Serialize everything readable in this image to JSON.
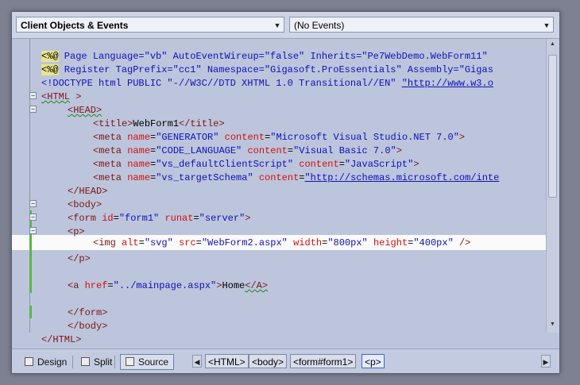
{
  "header": {
    "objects_combo": "Client Objects & Events",
    "events_combo": "(No Events)"
  },
  "code": {
    "l1_directive": "<%@",
    "l1_rest": " Page Language=\"vb\" AutoEventWireup=\"false\" Inherits=\"Pe7WebDemo.WebForm11\"",
    "l2_directive": "<%@",
    "l2_rest": " Register TagPrefix=\"cc1\" Namespace=\"Gigasoft.ProEssentials\" Assembly=\"Gigas",
    "l3_text": "<!DOCTYPE html PUBLIC \"-//W3C//DTD XHTML 1.0 Transitional//EN\" ",
    "l3_url": "\"http://www.w3.o",
    "l4_open": "<HTML",
    "l4_close": " >",
    "l5": "<HEAD>",
    "l6_a": "<title>",
    "l6_b": "WebForm1",
    "l6_c": "</title>",
    "meta_tag": "<meta",
    "name_attr": "name",
    "content_attr": "content",
    "l7_name": "\"GENERATOR\"",
    "l7_content": "\"Microsoft Visual Studio.NET 7.0\"",
    "l8_name": "\"CODE_LANGUAGE\"",
    "l8_content": "\"Visual Basic 7.0\"",
    "l9_name": "\"vs_defaultClientScript\"",
    "l9_content": "\"JavaScript\"",
    "l10_name": "\"vs_targetSchema\"",
    "l10_content": "\"http://schemas.microsoft.com/inte",
    "close_bracket": ">",
    "l11": "</HEAD>",
    "l12": "<body>",
    "l13_tag": "<form",
    "l13_id_attr": "id",
    "l13_id_val": "\"form1\"",
    "l13_runat_attr": "runat",
    "l13_runat_val": "\"server\"",
    "l14": "<p>",
    "l15_tag": "<img",
    "l15_alt": "alt",
    "l15_alt_val": "\"svg\"",
    "l15_src": "src",
    "l15_src_val": "\"WebForm2.aspx\"",
    "l15_width": "width",
    "l15_width_val": "\"800px\"",
    "l15_height": "height",
    "l15_height_val": "\"400px\"",
    "l15_end": " />",
    "l16": "</p>",
    "l18_tag": "<a",
    "l18_href": "href",
    "l18_href_val": "\"../mainpage.aspx\"",
    "l18_text": "Home",
    "l18_end": "</A>",
    "l20": "</form>",
    "l21": "</body>",
    "l22": "</HTML>"
  },
  "view_tabs": {
    "design": "Design",
    "split": "Split",
    "source": "Source"
  },
  "breadcrumb": [
    "<HTML>",
    "<body>",
    "<form#form1>",
    "<p>"
  ],
  "colors": {
    "editor_bg": "#bcc5dc",
    "current_line": "#fafafa",
    "tag": "#7d1515",
    "attribute": "#d01010",
    "value": "#1010b8",
    "change_bar": "#59b64a"
  }
}
